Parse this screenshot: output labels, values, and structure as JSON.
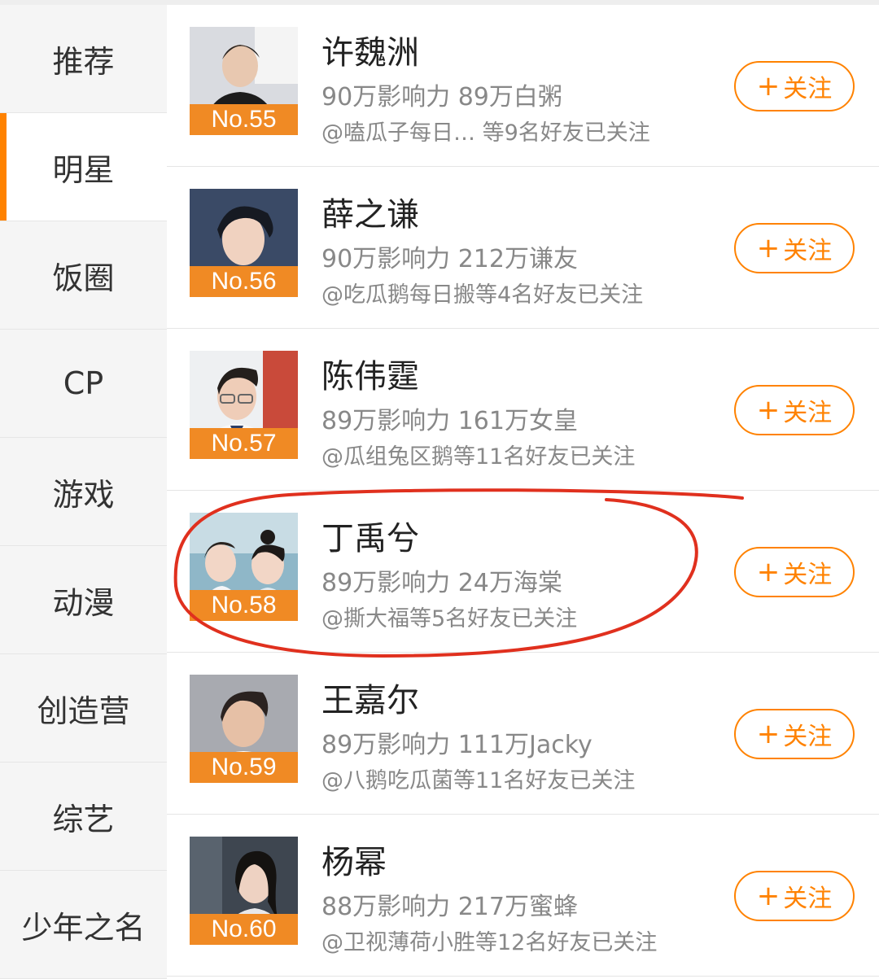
{
  "sidebar": {
    "items": [
      {
        "label": "推荐"
      },
      {
        "label": "明星"
      },
      {
        "label": "饭圈"
      },
      {
        "label": "CP"
      },
      {
        "label": "游戏"
      },
      {
        "label": "动漫"
      },
      {
        "label": "创造营"
      },
      {
        "label": "综艺"
      },
      {
        "label": "少年之名"
      }
    ],
    "active_index": 1
  },
  "follow_label": "关注",
  "accent_color": "#ff8200",
  "annotation_color": "#e0301e",
  "rows": [
    {
      "rank": "No.55",
      "name": "许魏洲",
      "stats": "90万影响力 89万白粥",
      "friends": "@嗑瓜子每日… 等9名好友已关注"
    },
    {
      "rank": "No.56",
      "name": "薛之谦",
      "stats": "90万影响力 212万谦友",
      "friends": "@吃瓜鹅每日搬等4名好友已关注"
    },
    {
      "rank": "No.57",
      "name": "陈伟霆",
      "stats": "89万影响力 161万女皇",
      "friends": "@瓜组兔区鹅等11名好友已关注"
    },
    {
      "rank": "No.58",
      "name": "丁禹兮",
      "stats": "89万影响力 24万海棠",
      "friends": "@撕大福等5名好友已关注"
    },
    {
      "rank": "No.59",
      "name": "王嘉尔",
      "stats": "89万影响力 111万Jacky",
      "friends": "@八鹅吃瓜菌等11名好友已关注"
    },
    {
      "rank": "No.60",
      "name": "杨幂",
      "stats": "88万影响力 217万蜜蜂",
      "friends": "@卫视薄荷小胜等12名好友已关注"
    }
  ]
}
